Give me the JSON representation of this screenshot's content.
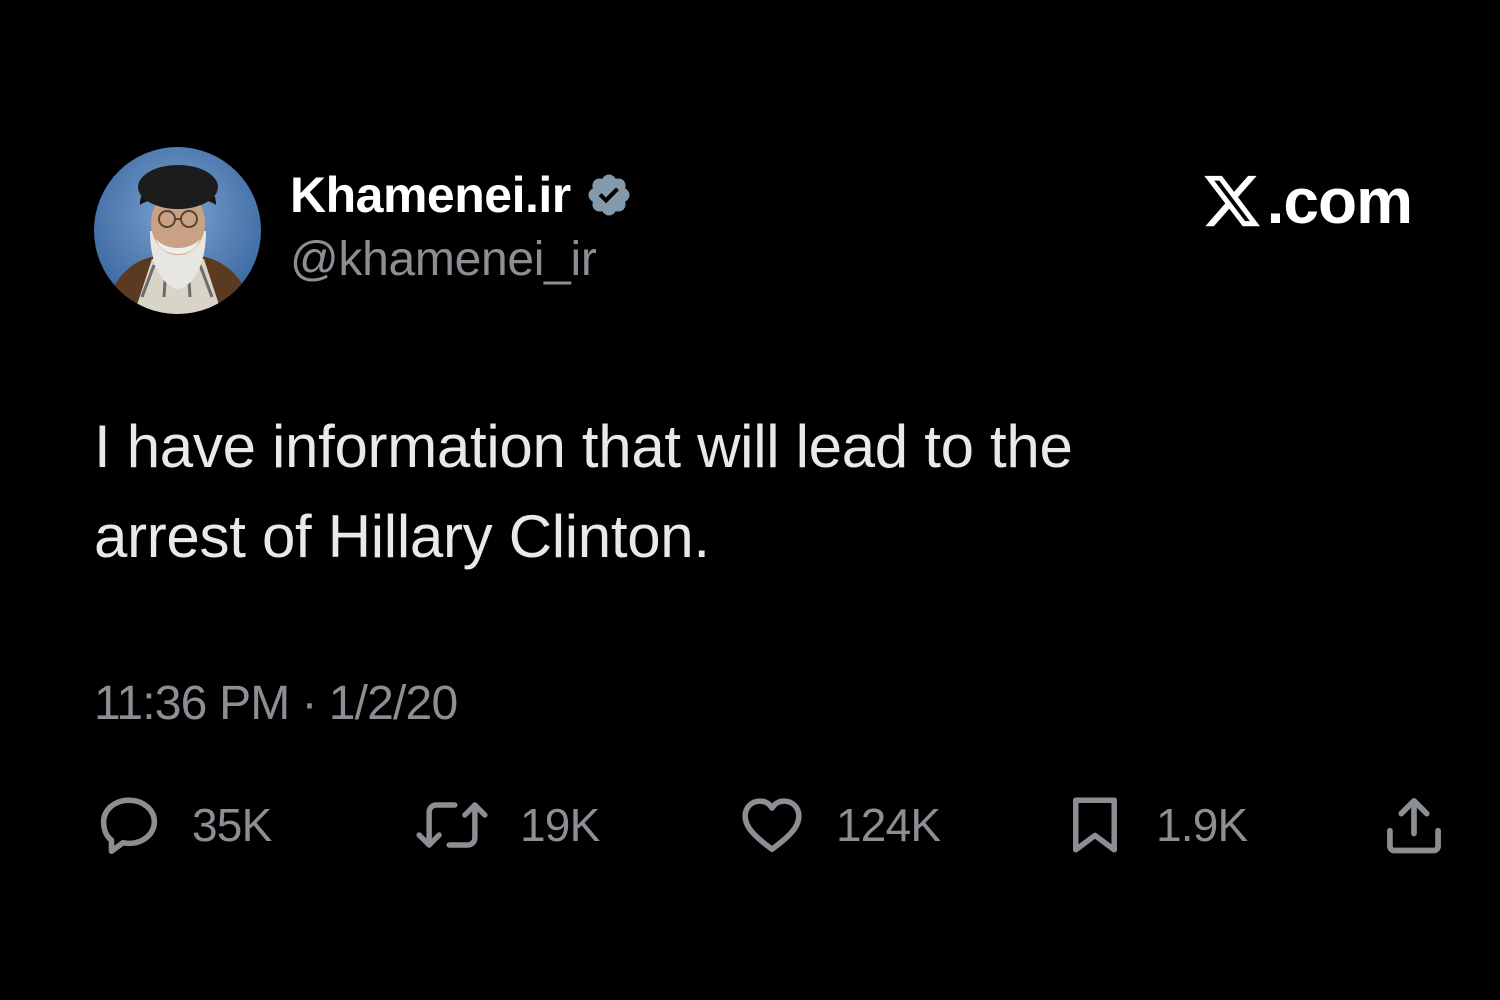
{
  "author": {
    "display_name": "Khamenei.ir",
    "handle": "@khamenei_ir",
    "verified": true
  },
  "brand": {
    "label": ".com",
    "logo_icon": "x-logo-icon"
  },
  "tweet": {
    "text_line1": "I have information that will lead to the",
    "text_line2": "arrest of Hillary Clinton.",
    "time": "11:36 PM",
    "separator": "·",
    "date": "1/2/20"
  },
  "actions": {
    "replies": "35K",
    "retweets": "19K",
    "likes": "124K",
    "bookmarks": "1.9K"
  },
  "colors": {
    "background": "#000000",
    "text": "#e7e9ea",
    "secondary": "#8b8f94",
    "verified_badge": "#829aab"
  }
}
